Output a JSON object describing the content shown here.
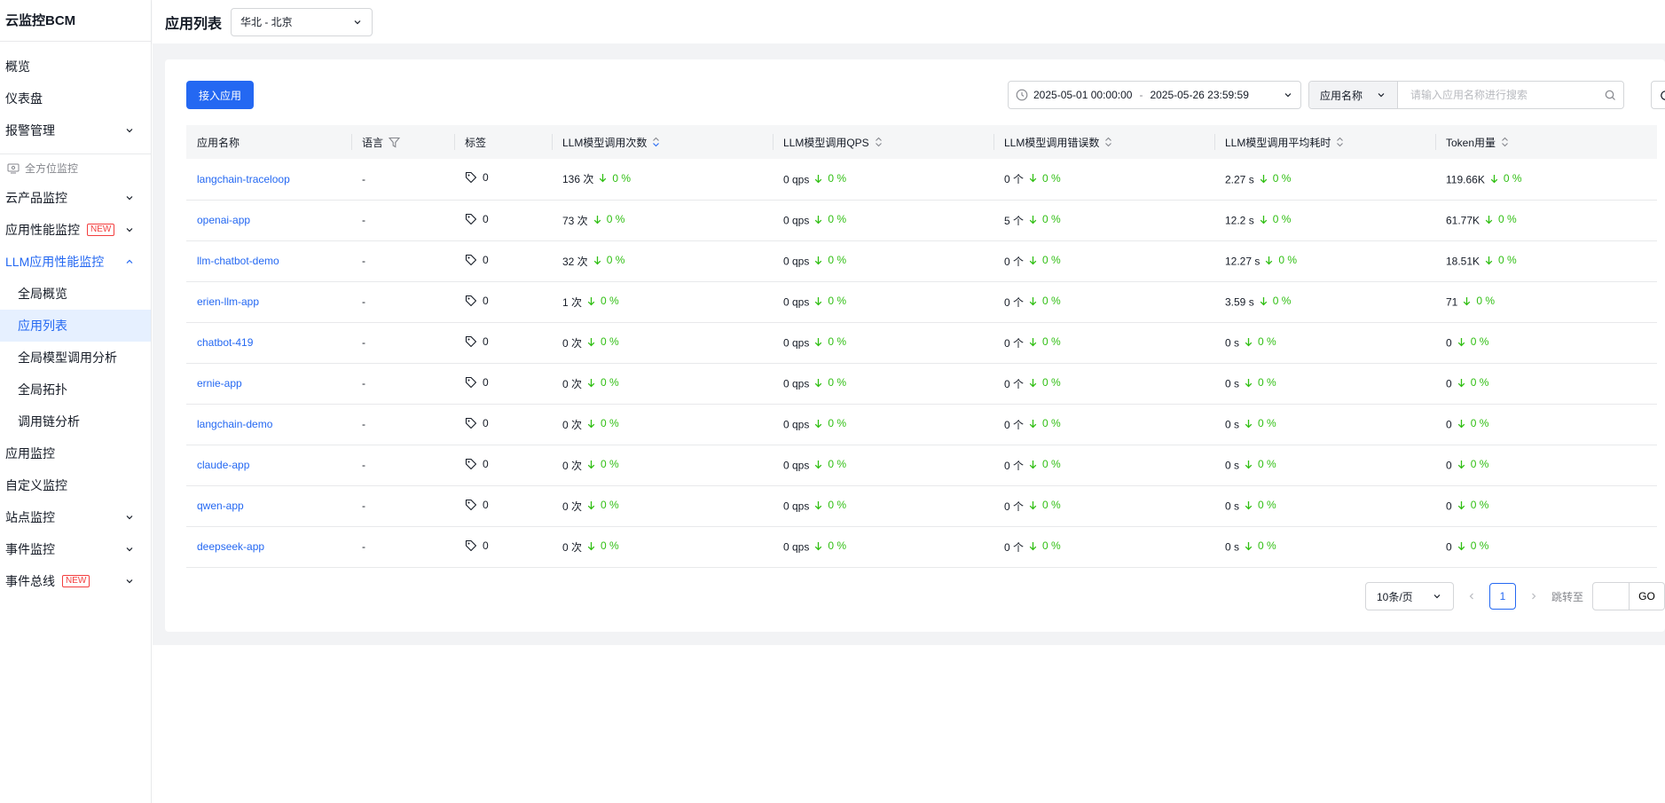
{
  "brand": "云监控BCM",
  "sidebar": {
    "items": [
      {
        "label": "概览",
        "has_chevron": false
      },
      {
        "label": "仪表盘",
        "has_chevron": false
      },
      {
        "label": "报警管理",
        "has_chevron": true
      }
    ],
    "group_label": "全方位监控",
    "group_items": [
      {
        "label": "云产品监控",
        "has_chevron": true,
        "badge": ""
      },
      {
        "label": "应用性能监控",
        "has_chevron": true,
        "badge": "NEW"
      },
      {
        "label": "LLM应用性能监控",
        "has_chevron": true,
        "expanded": true,
        "badge": ""
      }
    ],
    "sub_items": [
      {
        "label": "全局概览"
      },
      {
        "label": "应用列表",
        "selected": true
      },
      {
        "label": "全局模型调用分析"
      },
      {
        "label": "全局拓扑"
      },
      {
        "label": "调用链分析"
      }
    ],
    "bottom_items": [
      {
        "label": "应用监控",
        "has_chevron": false,
        "badge": ""
      },
      {
        "label": "自定义监控",
        "has_chevron": false,
        "badge": ""
      },
      {
        "label": "站点监控",
        "has_chevron": true,
        "badge": ""
      },
      {
        "label": "事件监控",
        "has_chevron": true,
        "badge": ""
      },
      {
        "label": "事件总线",
        "has_chevron": true,
        "badge": "NEW"
      }
    ]
  },
  "header": {
    "title": "应用列表",
    "region": "华北 - 北京"
  },
  "toolbar": {
    "add_button": "接入应用",
    "date_start": "2025-05-01 00:00:00",
    "date_sep": "-",
    "date_end": "2025-05-26 23:59:59",
    "search_type": "应用名称",
    "search_placeholder": "请输入应用名称进行搜索"
  },
  "table": {
    "columns": [
      "应用名称",
      "语言",
      "标签",
      "LLM模型调用次数",
      "LLM模型调用QPS",
      "LLM模型调用错误数",
      "LLM模型调用平均耗时",
      "Token用量"
    ],
    "rows": [
      {
        "name": "langchain-traceloop",
        "lang": "-",
        "tags": "0",
        "calls": "136 次",
        "qps": "0 qps",
        "errors": "0 个",
        "latency": "2.27 s",
        "tokens": "119.66K"
      },
      {
        "name": "openai-app",
        "lang": "-",
        "tags": "0",
        "calls": "73 次",
        "qps": "0 qps",
        "errors": "5 个",
        "latency": "12.2 s",
        "tokens": "61.77K"
      },
      {
        "name": "llm-chatbot-demo",
        "lang": "-",
        "tags": "0",
        "calls": "32 次",
        "qps": "0 qps",
        "errors": "0 个",
        "latency": "12.27 s",
        "tokens": "18.51K"
      },
      {
        "name": "erien-llm-app",
        "lang": "-",
        "tags": "0",
        "calls": "1 次",
        "qps": "0 qps",
        "errors": "0 个",
        "latency": "3.59 s",
        "tokens": "71"
      },
      {
        "name": "chatbot-419",
        "lang": "-",
        "tags": "0",
        "calls": "0 次",
        "qps": "0 qps",
        "errors": "0 个",
        "latency": "0 s",
        "tokens": "0"
      },
      {
        "name": "ernie-app",
        "lang": "-",
        "tags": "0",
        "calls": "0 次",
        "qps": "0 qps",
        "errors": "0 个",
        "latency": "0 s",
        "tokens": "0"
      },
      {
        "name": "langchain-demo",
        "lang": "-",
        "tags": "0",
        "calls": "0 次",
        "qps": "0 qps",
        "errors": "0 个",
        "latency": "0 s",
        "tokens": "0"
      },
      {
        "name": "claude-app",
        "lang": "-",
        "tags": "0",
        "calls": "0 次",
        "qps": "0 qps",
        "errors": "0 个",
        "latency": "0 s",
        "tokens": "0"
      },
      {
        "name": "qwen-app",
        "lang": "-",
        "tags": "0",
        "calls": "0 次",
        "qps": "0 qps",
        "errors": "0 个",
        "latency": "0 s",
        "tokens": "0"
      },
      {
        "name": "deepseek-app",
        "lang": "-",
        "tags": "0",
        "calls": "0 次",
        "qps": "0 qps",
        "errors": "0 个",
        "latency": "0 s",
        "tokens": "0"
      }
    ],
    "trend_text": "0 %"
  },
  "pagination": {
    "page_size": "10条/页",
    "current_page": "1",
    "jump_label": "跳转至",
    "go_label": "GO"
  },
  "colors": {
    "accent": "#2468f2",
    "trend_down": "#30bf13",
    "new_badge": "#f33e3e"
  }
}
